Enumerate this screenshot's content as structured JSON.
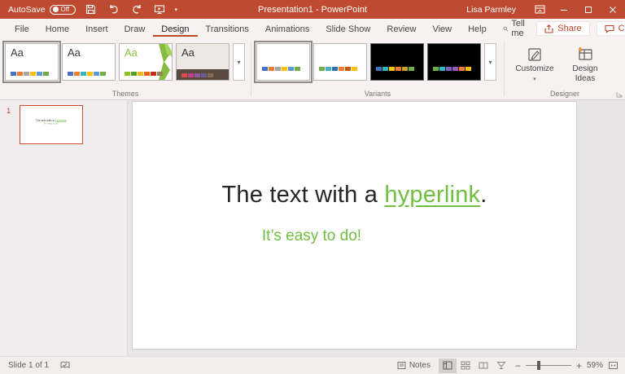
{
  "colors": {
    "accent": "#C0452B",
    "titlebar_bg": "#BE4B31",
    "ribbon_bg": "#F7F2F1",
    "content_bg": "#E7E5E5",
    "panel_bg": "#EFEDED",
    "statusbar_bg": "#F3EEED",
    "slide_green": "#70BF41",
    "text_dark": "#262626",
    "muted": "#605E5C"
  },
  "titlebar": {
    "autosave_label": "AutoSave",
    "autosave_state": "Off",
    "title": "Presentation1 - PowerPoint",
    "user_name": "Lisa Parmley"
  },
  "ribbon_tabs": [
    "File",
    "Home",
    "Insert",
    "Draw",
    "Design",
    "Transitions",
    "Animations",
    "Slide Show",
    "Review",
    "View",
    "Help"
  ],
  "tellme_label": "Tell me",
  "actions": {
    "share": "Share",
    "comments": "Comments"
  },
  "ribbon": {
    "themes": {
      "group_label": "Themes",
      "aa": "Aa",
      "more_glyph": "▾",
      "items": [
        {
          "aa_color": "#3B3B3B",
          "bg": "#FFFFFF",
          "swatches": [
            "#4472C4",
            "#ED7D31",
            "#A5A5A5",
            "#FFC000",
            "#5B9BD5",
            "#70AD47"
          ]
        },
        {
          "aa_color": "#3B3B3B",
          "bg": "#FFFFFF",
          "swatches": [
            "#4472C4",
            "#ED7D31",
            "#31B6BD",
            "#FFC000",
            "#5B9BD5",
            "#70AD47"
          ]
        },
        {
          "aa_color": "#8CC63E",
          "bg": "#FFFFFF",
          "swatches": [
            "#90C226",
            "#54A021",
            "#E6B91E",
            "#E76618",
            "#C42F1A",
            "#918655"
          ]
        },
        {
          "aa_color": "#333333",
          "bg": "",
          "swatches": [
            "#D94A4A",
            "#C2418E",
            "#8E5BA6",
            "#6B5B95",
            "#8A6A4F",
            "#5B4A3F"
          ]
        }
      ]
    },
    "variants": {
      "group_label": "Variants",
      "more_glyph": "▾",
      "items": [
        {
          "bg": "#FFFFFF",
          "swatches": [
            "#4472C4",
            "#ED7D31",
            "#A5A5A5",
            "#FFC000",
            "#5B9BD5",
            "#70AD47"
          ]
        },
        {
          "bg": "#FFFFFF",
          "swatches": [
            "#70AD47",
            "#4BACC6",
            "#2E75B6",
            "#ED7D31",
            "#C55A11",
            "#FFC000"
          ]
        },
        {
          "bg": "#000000",
          "swatches": [
            "#4472C4",
            "#31B6BD",
            "#FFC000",
            "#ED7D31",
            "#C8A227",
            "#70AD47"
          ]
        },
        {
          "bg": "#000000",
          "swatches": [
            "#70AD47",
            "#31B6BD",
            "#7C5CBF",
            "#9B59B6",
            "#ED7D31",
            "#FFC000"
          ]
        }
      ]
    },
    "designer": {
      "group_label": "Designer",
      "customize_label": "Customize",
      "design_ideas_label": "Design Ideas"
    }
  },
  "slide_panel": {
    "slide_number": "1"
  },
  "slide": {
    "title_prefix": "The text with a ",
    "title_link": "hyperlink",
    "title_suffix": ".",
    "subtitle": "It’s easy to do!"
  },
  "statusbar": {
    "slide_indicator": "Slide 1 of 1",
    "notes_label": "Notes",
    "zoom_percent": "59%"
  }
}
